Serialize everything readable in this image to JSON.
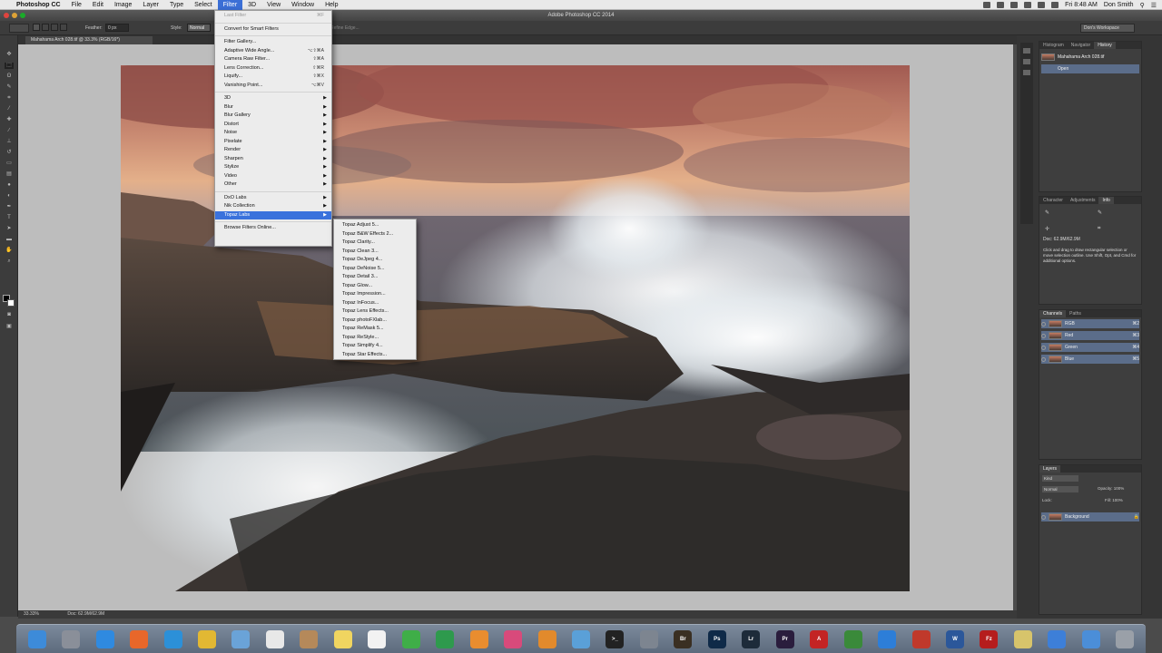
{
  "menubar": {
    "apple": "",
    "app": "Photoshop CC",
    "items": [
      "File",
      "Edit",
      "Image",
      "Layer",
      "Type",
      "Select",
      "Filter",
      "3D",
      "View",
      "Window",
      "Help"
    ],
    "active": "Filter",
    "time": "Fri 8:48 AM",
    "user": "Don Smith"
  },
  "window": {
    "title": "Adobe Photoshop CC 2014",
    "doc_tab": "Mahahama Arch 028.tif @ 33.3% (RGB/16*)",
    "workspace": "Don's Workspace",
    "status_zoom": "33.33%",
    "status_doc": "Doc: 62.9M/62.9M"
  },
  "options": {
    "feather_label": "Feather:",
    "feather_value": "0 px",
    "style_label": "Style:",
    "style_value": "Normal",
    "refine": "Refine Edge..."
  },
  "filter_menu": {
    "items": [
      {
        "label": "Last Filter",
        "shortcut": "⌘F",
        "disabled": true
      },
      {
        "sep": true
      },
      {
        "label": "Convert for Smart Filters"
      },
      {
        "sep": true
      },
      {
        "label": "Filter Gallery..."
      },
      {
        "label": "Adaptive Wide Angle...",
        "shortcut": "⌥⇧⌘A"
      },
      {
        "label": "Camera Raw Filter...",
        "shortcut": "⇧⌘A"
      },
      {
        "label": "Lens Correction...",
        "shortcut": "⇧⌘R"
      },
      {
        "label": "Liquify...",
        "shortcut": "⇧⌘X"
      },
      {
        "label": "Vanishing Point...",
        "shortcut": "⌥⌘V"
      },
      {
        "sep": true
      },
      {
        "label": "3D",
        "submenu": true
      },
      {
        "label": "Blur",
        "submenu": true
      },
      {
        "label": "Blur Gallery",
        "submenu": true
      },
      {
        "label": "Distort",
        "submenu": true
      },
      {
        "label": "Noise",
        "submenu": true
      },
      {
        "label": "Pixelate",
        "submenu": true
      },
      {
        "label": "Render",
        "submenu": true
      },
      {
        "label": "Sharpen",
        "submenu": true
      },
      {
        "label": "Stylize",
        "submenu": true
      },
      {
        "label": "Video",
        "submenu": true
      },
      {
        "label": "Other",
        "submenu": true
      },
      {
        "sep": true
      },
      {
        "label": "DxO Labs",
        "submenu": true
      },
      {
        "label": "Nik Collection",
        "submenu": true
      },
      {
        "label": "Topaz Labs",
        "submenu": true,
        "highlighted": true
      },
      {
        "sep": true
      },
      {
        "label": "Browse Filters Online..."
      }
    ]
  },
  "topaz_menu": {
    "items": [
      "Topaz Adjust 5...",
      "Topaz B&W Effects 2...",
      "Topaz Clarity...",
      "Topaz Clean 3...",
      "Topaz DeJpeg 4...",
      "Topaz DeNoise 5...",
      "Topaz Detail 3...",
      "Topaz Glow...",
      "Topaz Impression...",
      "Topaz InFocus...",
      "Topaz Lens Effects...",
      "Topaz photoFXlab...",
      "Topaz ReMask 5...",
      "Topaz ReStyle...",
      "Topaz Simplify 4...",
      "Topaz Star Effects..."
    ]
  },
  "panels": {
    "history": {
      "tabs": [
        "Histogram",
        "Navigator",
        "History"
      ],
      "snapshot": "Mahahama Arch 028.tif",
      "step": "Open"
    },
    "info": {
      "tabs": [
        "Character",
        "Adjustments",
        "Info"
      ],
      "doc": "Doc: 62.9M/62.9M",
      "hint": "Click and drag to draw rectangular selection or move selection outline. Use Shift, Opt, and Cmd for additional options."
    },
    "channels": {
      "tabs": [
        "Channels",
        "Paths"
      ],
      "rows": [
        {
          "name": "RGB",
          "key": "⌘2"
        },
        {
          "name": "Red",
          "key": "⌘3"
        },
        {
          "name": "Green",
          "key": "⌘4"
        },
        {
          "name": "Blue",
          "key": "⌘5"
        }
      ]
    },
    "layers": {
      "tabs": [
        "Layers"
      ],
      "kind": "Kind",
      "blend": "Normal",
      "opacity": "Opacity: 100%",
      "lock": "Lock:",
      "fill": "Fill: 100%",
      "layer": "Background"
    }
  },
  "dock": {
    "apps": [
      "Finder",
      "Launchpad",
      "App Store",
      "Firefox",
      "Safari",
      "Chrome",
      "Mail",
      "Calendar",
      "Contacts",
      "Notes",
      "Reminders",
      "Messages",
      "FaceTime",
      "Photos",
      "iTunes",
      "iBooks",
      "Preview",
      "Terminal",
      "System Preferences",
      "Bridge",
      "Photoshop",
      "Lightroom",
      "Premiere",
      "Acrobat",
      "Camtasia",
      "Dropbox",
      "PDF",
      "Word",
      "FileZilla",
      "Notes",
      "Downloads",
      "Documents",
      "Trash"
    ]
  }
}
